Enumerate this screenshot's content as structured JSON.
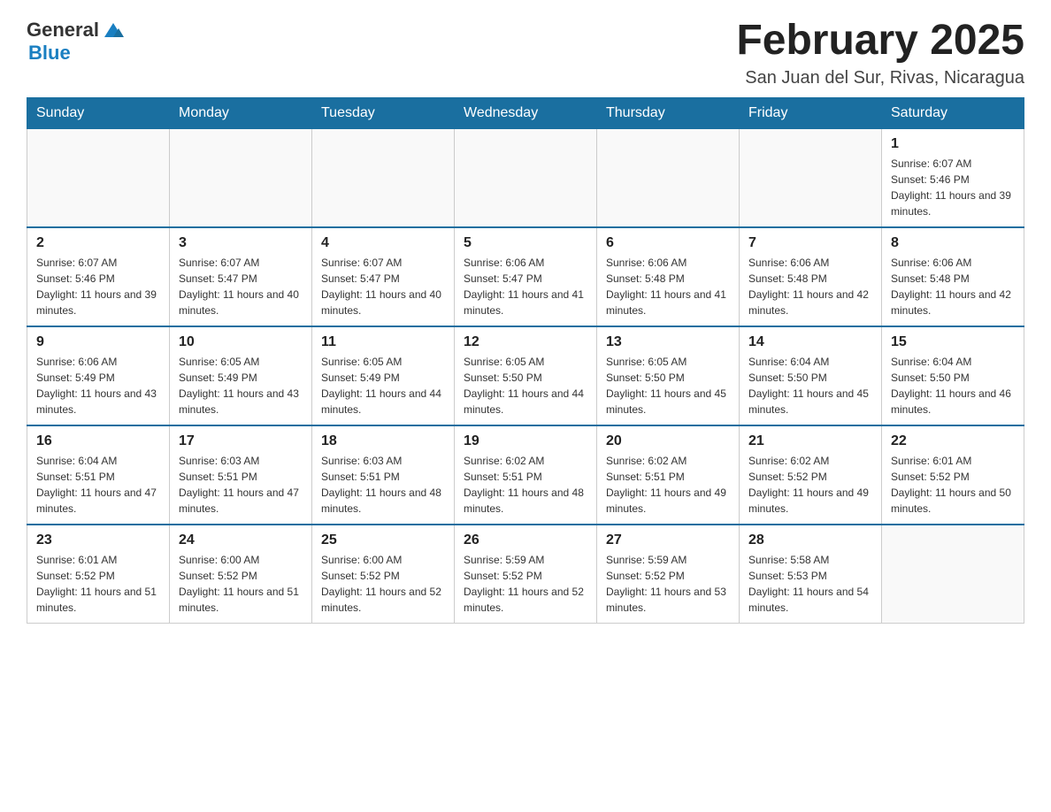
{
  "header": {
    "logo": {
      "general": "General",
      "blue": "Blue"
    },
    "title": "February 2025",
    "location": "San Juan del Sur, Rivas, Nicaragua"
  },
  "days_of_week": [
    "Sunday",
    "Monday",
    "Tuesday",
    "Wednesday",
    "Thursday",
    "Friday",
    "Saturday"
  ],
  "weeks": [
    [
      {
        "day": "",
        "info": ""
      },
      {
        "day": "",
        "info": ""
      },
      {
        "day": "",
        "info": ""
      },
      {
        "day": "",
        "info": ""
      },
      {
        "day": "",
        "info": ""
      },
      {
        "day": "",
        "info": ""
      },
      {
        "day": "1",
        "info": "Sunrise: 6:07 AM\nSunset: 5:46 PM\nDaylight: 11 hours and 39 minutes."
      }
    ],
    [
      {
        "day": "2",
        "info": "Sunrise: 6:07 AM\nSunset: 5:46 PM\nDaylight: 11 hours and 39 minutes."
      },
      {
        "day": "3",
        "info": "Sunrise: 6:07 AM\nSunset: 5:47 PM\nDaylight: 11 hours and 40 minutes."
      },
      {
        "day": "4",
        "info": "Sunrise: 6:07 AM\nSunset: 5:47 PM\nDaylight: 11 hours and 40 minutes."
      },
      {
        "day": "5",
        "info": "Sunrise: 6:06 AM\nSunset: 5:47 PM\nDaylight: 11 hours and 41 minutes."
      },
      {
        "day": "6",
        "info": "Sunrise: 6:06 AM\nSunset: 5:48 PM\nDaylight: 11 hours and 41 minutes."
      },
      {
        "day": "7",
        "info": "Sunrise: 6:06 AM\nSunset: 5:48 PM\nDaylight: 11 hours and 42 minutes."
      },
      {
        "day": "8",
        "info": "Sunrise: 6:06 AM\nSunset: 5:48 PM\nDaylight: 11 hours and 42 minutes."
      }
    ],
    [
      {
        "day": "9",
        "info": "Sunrise: 6:06 AM\nSunset: 5:49 PM\nDaylight: 11 hours and 43 minutes."
      },
      {
        "day": "10",
        "info": "Sunrise: 6:05 AM\nSunset: 5:49 PM\nDaylight: 11 hours and 43 minutes."
      },
      {
        "day": "11",
        "info": "Sunrise: 6:05 AM\nSunset: 5:49 PM\nDaylight: 11 hours and 44 minutes."
      },
      {
        "day": "12",
        "info": "Sunrise: 6:05 AM\nSunset: 5:50 PM\nDaylight: 11 hours and 44 minutes."
      },
      {
        "day": "13",
        "info": "Sunrise: 6:05 AM\nSunset: 5:50 PM\nDaylight: 11 hours and 45 minutes."
      },
      {
        "day": "14",
        "info": "Sunrise: 6:04 AM\nSunset: 5:50 PM\nDaylight: 11 hours and 45 minutes."
      },
      {
        "day": "15",
        "info": "Sunrise: 6:04 AM\nSunset: 5:50 PM\nDaylight: 11 hours and 46 minutes."
      }
    ],
    [
      {
        "day": "16",
        "info": "Sunrise: 6:04 AM\nSunset: 5:51 PM\nDaylight: 11 hours and 47 minutes."
      },
      {
        "day": "17",
        "info": "Sunrise: 6:03 AM\nSunset: 5:51 PM\nDaylight: 11 hours and 47 minutes."
      },
      {
        "day": "18",
        "info": "Sunrise: 6:03 AM\nSunset: 5:51 PM\nDaylight: 11 hours and 48 minutes."
      },
      {
        "day": "19",
        "info": "Sunrise: 6:02 AM\nSunset: 5:51 PM\nDaylight: 11 hours and 48 minutes."
      },
      {
        "day": "20",
        "info": "Sunrise: 6:02 AM\nSunset: 5:51 PM\nDaylight: 11 hours and 49 minutes."
      },
      {
        "day": "21",
        "info": "Sunrise: 6:02 AM\nSunset: 5:52 PM\nDaylight: 11 hours and 49 minutes."
      },
      {
        "day": "22",
        "info": "Sunrise: 6:01 AM\nSunset: 5:52 PM\nDaylight: 11 hours and 50 minutes."
      }
    ],
    [
      {
        "day": "23",
        "info": "Sunrise: 6:01 AM\nSunset: 5:52 PM\nDaylight: 11 hours and 51 minutes."
      },
      {
        "day": "24",
        "info": "Sunrise: 6:00 AM\nSunset: 5:52 PM\nDaylight: 11 hours and 51 minutes."
      },
      {
        "day": "25",
        "info": "Sunrise: 6:00 AM\nSunset: 5:52 PM\nDaylight: 11 hours and 52 minutes."
      },
      {
        "day": "26",
        "info": "Sunrise: 5:59 AM\nSunset: 5:52 PM\nDaylight: 11 hours and 52 minutes."
      },
      {
        "day": "27",
        "info": "Sunrise: 5:59 AM\nSunset: 5:52 PM\nDaylight: 11 hours and 53 minutes."
      },
      {
        "day": "28",
        "info": "Sunrise: 5:58 AM\nSunset: 5:53 PM\nDaylight: 11 hours and 54 minutes."
      },
      {
        "day": "",
        "info": ""
      }
    ]
  ]
}
